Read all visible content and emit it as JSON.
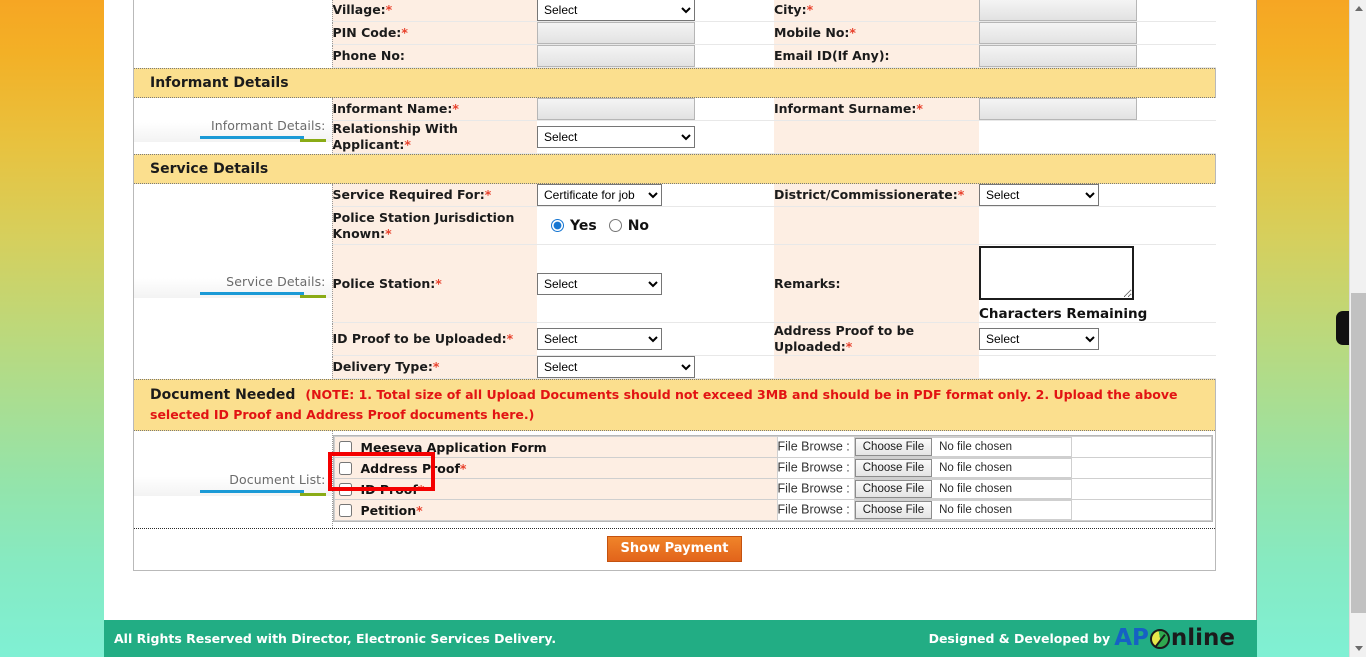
{
  "address_section": {
    "rows": [
      {
        "left_label": "Village:",
        "left_required": true,
        "left_control": "select",
        "left_value": "Select",
        "right_label": "City:",
        "right_required": true,
        "right_control": "input",
        "right_value": ""
      },
      {
        "left_label": "PIN Code:",
        "left_required": true,
        "left_control": "input",
        "left_value": "",
        "right_label": "Mobile No:",
        "right_required": true,
        "right_control": "input",
        "right_value": ""
      },
      {
        "left_label": "Phone No:",
        "left_required": false,
        "left_control": "input",
        "left_value": "",
        "right_label": "Email ID(If Any):",
        "right_required": false,
        "right_control": "input",
        "right_value": ""
      }
    ]
  },
  "informant_section": {
    "header": "Informant Details",
    "side_label": "Informant Details:",
    "rows": [
      {
        "left_label": "Informant Name:",
        "left_required": true,
        "left_control": "input",
        "left_value": "",
        "right_label": "Informant Surname:",
        "right_required": true,
        "right_control": "input",
        "right_value": ""
      },
      {
        "left_label": "Relationship With Applicant:",
        "left_required": true,
        "left_control": "select",
        "left_value": "Select",
        "right_label": "",
        "right_required": false,
        "right_control": "none",
        "right_value": ""
      }
    ]
  },
  "service_section": {
    "header": "Service Details",
    "side_label": "Service Details:",
    "service_required_for_label": "Service Required For:",
    "service_required_for_value": "Certificate for job",
    "district_label": "District/Commissionerate:",
    "district_value": "Select",
    "jurisdiction_label": "Police Station Jurisdiction Known:",
    "jurisdiction_yes": "Yes",
    "jurisdiction_no": "No",
    "jurisdiction_selected": "Yes",
    "police_station_label": "Police Station:",
    "police_station_value": "Select",
    "remarks_label": "Remarks:",
    "remarks_value": "",
    "chars_remaining_label": "Characters Remaining",
    "id_proof_label": "ID Proof to be Uploaded:",
    "id_proof_value": "Select",
    "address_proof_label": "Address Proof to be Uploaded:",
    "address_proof_value": "Select",
    "delivery_type_label": "Delivery Type:",
    "delivery_type_value": "Select"
  },
  "document_section": {
    "header": "Document Needed",
    "note": "(NOTE: 1. Total size of all Upload Documents should not exceed 3MB and should be in PDF format only. 2. Upload the above selected ID Proof and Address Proof documents here.)",
    "side_label": "Document List:",
    "file_browse_label": "File Browse :",
    "choose_file_label": "Choose File",
    "no_file_label": "No file chosen",
    "documents": [
      {
        "name": "Meeseva Application Form",
        "required": false,
        "checked": false
      },
      {
        "name": "Address Proof",
        "required": true,
        "checked": false
      },
      {
        "name": "ID Proof",
        "required": true,
        "checked": false
      },
      {
        "name": "Petition",
        "required": true,
        "checked": false
      }
    ]
  },
  "submit": {
    "label": "Show Payment"
  },
  "footer": {
    "copyright": "All Rights Reserved with Director, Electronic Services Delivery.",
    "developed_by": "Designed & Developed by",
    "logo_ap": "AP",
    "logo_o": "O",
    "logo_nline": "nline"
  },
  "colors": {
    "section_bar": "#fbdf8e",
    "label_bg": "#fdeee3",
    "required_star": "#e8412c",
    "note_red": "#e21313",
    "footer_teal": "#22ad84",
    "button_orange": "#e2641b",
    "highlight_red": "#f40000",
    "rule_blue": "#1b9ad6",
    "rule_olive": "#8aab16"
  }
}
